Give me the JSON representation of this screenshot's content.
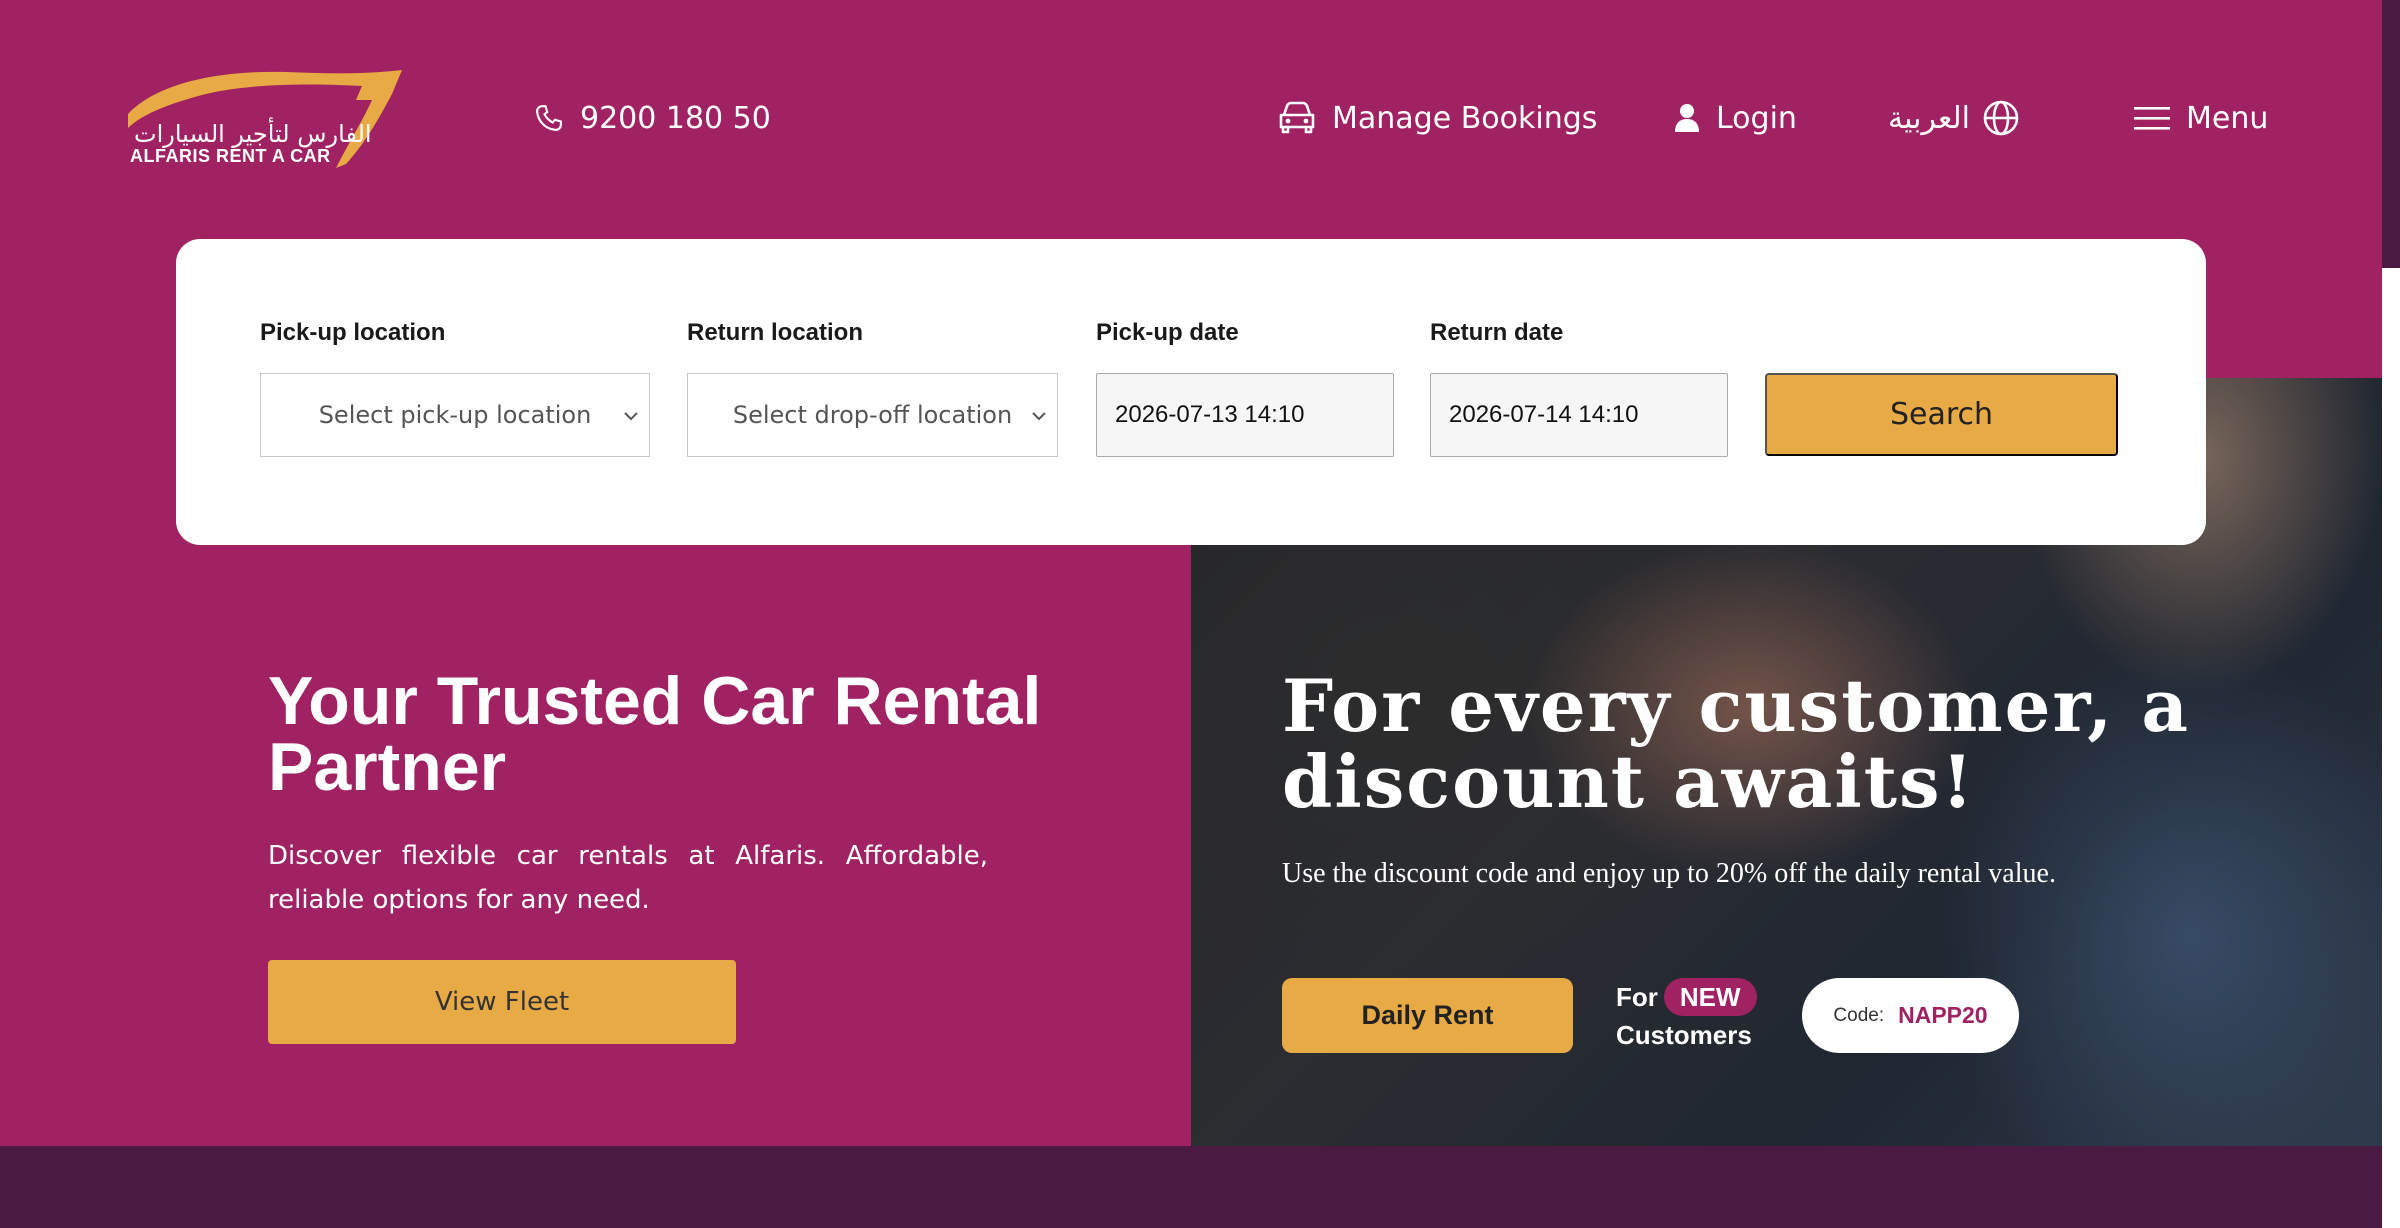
{
  "header": {
    "logo_ar": "الفارس لتأجير السيارات",
    "logo_en": "ALFARIS RENT A CAR",
    "phone": "9200 180 50",
    "manage_bookings": "Manage Bookings",
    "login": "Login",
    "language": "العربية",
    "menu": "Menu"
  },
  "search": {
    "pickup_location_label": "Pick-up location",
    "pickup_location_placeholder": "Select pick-up location",
    "return_location_label": "Return location",
    "return_location_placeholder": "Select drop-off location",
    "pickup_date_label": "Pick-up date",
    "pickup_date_value": "2026-07-13 14:10",
    "return_date_label": "Return date",
    "return_date_value": "2026-07-14 14:10",
    "search_button": "Search"
  },
  "hero": {
    "title": "Your Trusted Car Rental Partner",
    "description": "Discover flexible car rentals at Alfaris. Affordable, reliable options for any need.",
    "view_fleet_button": "View Fleet"
  },
  "promo": {
    "title": "For every customer, a discount awaits!",
    "description": "Use the discount code and enjoy up to 20% off the daily rental value.",
    "daily_rent_button": "Daily Rent",
    "for_label": "For",
    "new_badge": "NEW",
    "customers_label": "Customers",
    "code_label": "Code:",
    "code_value": "NAPP20"
  },
  "colors": {
    "brand": "#a02262",
    "accent": "#e8aa45",
    "dark_band": "#4a1a42"
  },
  "icons": [
    "phone-icon",
    "car-icon",
    "user-icon",
    "globe-icon",
    "hamburger-icon",
    "chevron-down-icon"
  ]
}
